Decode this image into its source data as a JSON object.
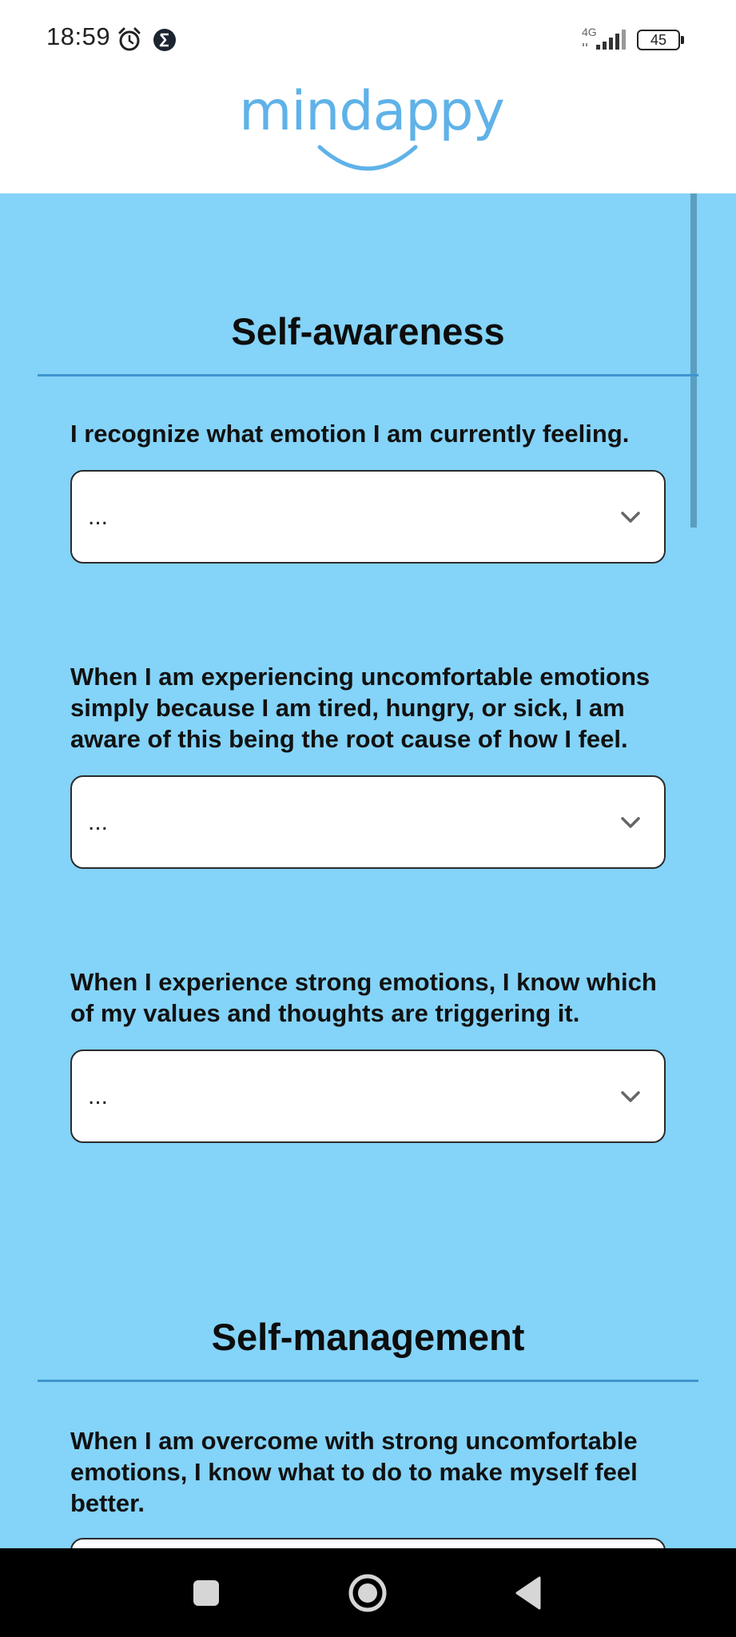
{
  "status_bar": {
    "time": "18:59",
    "network": "4G",
    "battery": "45",
    "icons": [
      "alarm-icon",
      "sigma-notification-icon",
      "signal-icon",
      "battery-icon"
    ]
  },
  "header": {
    "logo": "mindappy",
    "logo_color": "#5fb2e8"
  },
  "colors": {
    "content_background": "#84d3f8",
    "divider": "#3e95cf"
  },
  "sections": [
    {
      "title": "Self-awareness",
      "questions": [
        {
          "text": "I recognize what emotion I am currently feeling.",
          "value": "..."
        },
        {
          "text": "When I am experiencing uncomfortable emotions simply because I am tired, hungry, or sick, I am aware of this being the root cause of how I feel.",
          "value": "..."
        },
        {
          "text": "When I experience strong emotions, I know which of my values and thoughts are triggering it.",
          "value": "..."
        }
      ]
    },
    {
      "title": "Self-management",
      "questions": [
        {
          "text": "When I am overcome with strong uncomfortable emotions, I know what to do to make myself feel better.",
          "value": ""
        }
      ]
    }
  ],
  "nav_bar": {
    "buttons": [
      "recents-square-icon",
      "home-circle-icon",
      "back-triangle-icon"
    ]
  }
}
